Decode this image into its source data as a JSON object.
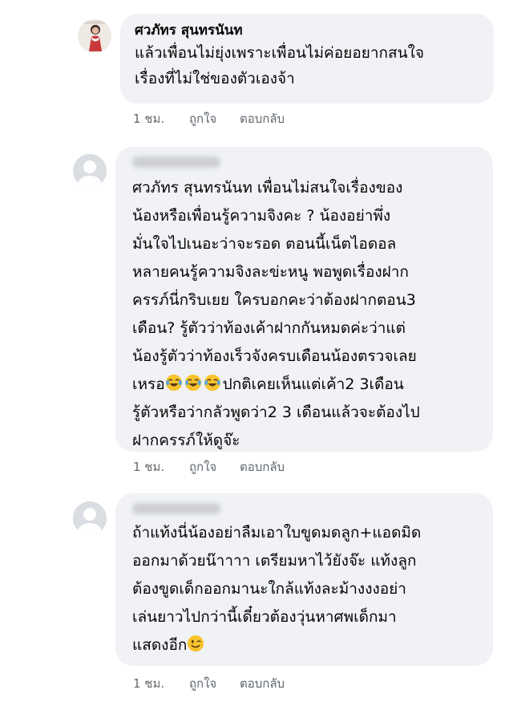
{
  "comments": [
    {
      "author": "ศวภัทร สุนทรนันท",
      "lines": [
        "แล้วเพื่อนไม่ยุ่งเพราะเพื่อนไม่ค่อยอยากสนใจ",
        "เรื่องที่ไม่ใช่ของตัวเองจ้า"
      ],
      "time": "1 ชม.",
      "like": "ถูกใจ",
      "reply": "ตอบกลับ"
    },
    {
      "lines": [
        "ศวภัทร สุนทรนันท  เพื่อนไม่สนใจเรื่องของ",
        "น้องหรือเพื่อนรู้ความจิงคะ ? น้องอย่าพึ่ง",
        "มั่นใจไปเนอะว่าจะรอด ตอนนี้เน็ตไอดอล",
        "หลายคนรู้ความจิงละข่ะหนู พอพูดเรื่องฝาก",
        "ครรภ์นี่กริบเยย ใครบอกคะว่าต้องฝากตอน3",
        "เดือน? รู้ตัวว่าท้องเค้าฝากกันหมดค่ะว่าแต่",
        "น้องรู้ตัวว่าท้องเร็วจังครบเดือนน้องตรวจเลย"
      ],
      "line8_before": "เหรอ",
      "line8_after": "ปกติเคยเห็นแต่เค้า2 3เดือน",
      "lines_tail": [
        "รู้ตัวหรือว่ากลัวพูดว่า2 3 เดือนแล้วจะต้องไป",
        "ฝากครรภ์ให้ดูจ๊ะ"
      ],
      "time": "1 ชม.",
      "like": "ถูกใจ",
      "reply": "ตอบกลับ"
    },
    {
      "lines": [
        "ถ้าแท้งนี่น้องอย่าลืมเอาใบขูดมดลูก+แอดมิด",
        "ออกมาด้วยน๊าาาา เตรียมหาไว้ยังจ๊ะ แท้งลูก",
        "ต้องขูดเด็กออกมานะใกล้แท้งละม้างงงอย่า",
        "เล่นยาวไปกว่านี้เดี๋ยวต้องวุ่นหาศพเด็กมา"
      ],
      "last_line": "แสดงอีก",
      "time": "1 ชม.",
      "like": "ถูกใจ",
      "reply": "ตอบกลับ"
    }
  ],
  "colors": {
    "bubble": "#f0f2f5",
    "text": "#050505",
    "meta": "#606770",
    "emoji": "#f7c32e"
  },
  "icons": {
    "laugh": "face-with-tears-of-joy-icon",
    "wink": "winking-face-icon",
    "default_avatar": "default-avatar-icon"
  }
}
